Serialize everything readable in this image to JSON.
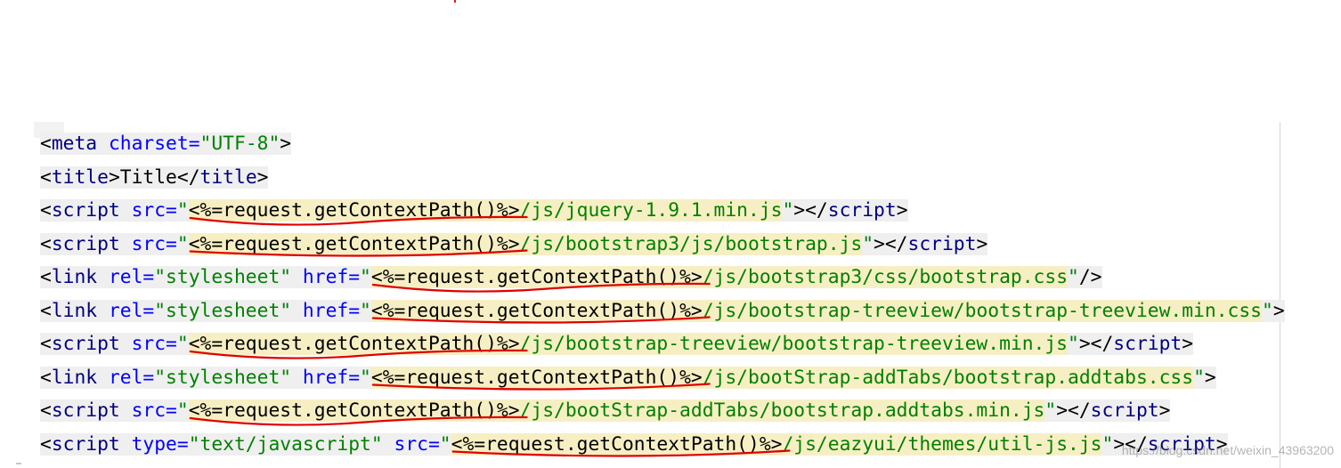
{
  "editor": {
    "lines": [
      {
        "id": "l1",
        "parts": [
          {
            "t": "<",
            "c": "bracket"
          },
          {
            "t": "meta",
            "c": "tag"
          },
          {
            "t": " charset=",
            "c": "attr"
          },
          {
            "t": "\"UTF-8\"",
            "c": "str"
          },
          {
            "t": ">",
            "c": "bracket"
          }
        ]
      },
      {
        "id": "l2",
        "parts": [
          {
            "t": "<",
            "c": "bracket"
          },
          {
            "t": "title",
            "c": "tag"
          },
          {
            "t": ">",
            "c": "bracket"
          },
          {
            "t": "Title",
            "c": "txt"
          },
          {
            "t": "</",
            "c": "bracket"
          },
          {
            "t": "title",
            "c": "tag"
          },
          {
            "t": ">",
            "c": "bracket"
          }
        ]
      },
      {
        "id": "l3",
        "parts": [
          {
            "t": "<",
            "c": "bracket"
          },
          {
            "t": "script",
            "c": "tag"
          },
          {
            "t": " src=",
            "c": "attr"
          },
          {
            "t": "\"",
            "c": "str"
          },
          {
            "t": "<%=request.getContextPath()%>",
            "c": "jsp"
          },
          {
            "t": "/js/jquery-1.9.1.min.js",
            "c": "strbg"
          },
          {
            "t": "\"",
            "c": "str"
          },
          {
            "t": "></",
            "c": "bracket"
          },
          {
            "t": "script",
            "c": "tag"
          },
          {
            "t": ">",
            "c": "bracket"
          }
        ]
      },
      {
        "id": "l4",
        "parts": [
          {
            "t": "<",
            "c": "bracket"
          },
          {
            "t": "script",
            "c": "tag"
          },
          {
            "t": " src=",
            "c": "attr"
          },
          {
            "t": "\"",
            "c": "str"
          },
          {
            "t": "<%=request.getContextPath()%>",
            "c": "jsp"
          },
          {
            "t": "/js/bootstrap3/js/bootstrap.js",
            "c": "strbg"
          },
          {
            "t": "\"",
            "c": "str"
          },
          {
            "t": "></",
            "c": "bracket"
          },
          {
            "t": "script",
            "c": "tag"
          },
          {
            "t": ">",
            "c": "bracket"
          }
        ]
      },
      {
        "id": "l5",
        "parts": [
          {
            "t": "<",
            "c": "bracket"
          },
          {
            "t": "link",
            "c": "tag"
          },
          {
            "t": " rel=",
            "c": "attr"
          },
          {
            "t": "\"stylesheet\"",
            "c": "str"
          },
          {
            "t": " href=",
            "c": "attr"
          },
          {
            "t": "\"",
            "c": "str"
          },
          {
            "t": "<%=request.getContextPath()%>",
            "c": "jsp"
          },
          {
            "t": "/js/bootstrap3/css/bootstrap.css",
            "c": "strbg"
          },
          {
            "t": "\"",
            "c": "str"
          },
          {
            "t": "/>",
            "c": "bracket"
          }
        ]
      },
      {
        "id": "l6",
        "parts": [
          {
            "t": "<",
            "c": "bracket"
          },
          {
            "t": "link",
            "c": "tag"
          },
          {
            "t": " rel=",
            "c": "attr"
          },
          {
            "t": "\"stylesheet\"",
            "c": "str"
          },
          {
            "t": " href=",
            "c": "attr"
          },
          {
            "t": "\"",
            "c": "str"
          },
          {
            "t": "<%=request.getContextPath()%>",
            "c": "jsp"
          },
          {
            "t": "/js/bootstrap-treeview/bootstrap-treeview.min.css",
            "c": "strbg"
          },
          {
            "t": "\"",
            "c": "str"
          },
          {
            "t": ">",
            "c": "bracket"
          }
        ]
      },
      {
        "id": "l7",
        "parts": [
          {
            "t": "<",
            "c": "bracket"
          },
          {
            "t": "script",
            "c": "tag"
          },
          {
            "t": " src=",
            "c": "attr"
          },
          {
            "t": "\"",
            "c": "str"
          },
          {
            "t": "<%=request.getContextPath()%>",
            "c": "jsp"
          },
          {
            "t": "/js/bootstrap-treeview/bootstrap-treeview.min.js",
            "c": "strbg"
          },
          {
            "t": "\"",
            "c": "str"
          },
          {
            "t": "></",
            "c": "bracket"
          },
          {
            "t": "script",
            "c": "tag"
          },
          {
            "t": ">",
            "c": "bracket"
          }
        ]
      },
      {
        "id": "l8",
        "parts": [
          {
            "t": "<",
            "c": "bracket"
          },
          {
            "t": "link",
            "c": "tag"
          },
          {
            "t": " rel=",
            "c": "attr"
          },
          {
            "t": "\"stylesheet\"",
            "c": "str"
          },
          {
            "t": " href=",
            "c": "attr"
          },
          {
            "t": "\"",
            "c": "str"
          },
          {
            "t": "<%=request.getContextPath()%>",
            "c": "jsp"
          },
          {
            "t": "/js/bootStrap-addTabs/bootstrap.addtabs.css",
            "c": "strbg"
          },
          {
            "t": "\"",
            "c": "str"
          },
          {
            "t": ">",
            "c": "bracket"
          }
        ]
      },
      {
        "id": "l9",
        "parts": [
          {
            "t": "<",
            "c": "bracket"
          },
          {
            "t": "script",
            "c": "tag"
          },
          {
            "t": " src=",
            "c": "attr"
          },
          {
            "t": "\"",
            "c": "str"
          },
          {
            "t": "<%=request.getContextPath()%>",
            "c": "jsp"
          },
          {
            "t": "/js/bootStrap-addTabs/bootstrap.addtabs.min.js",
            "c": "strbg"
          },
          {
            "t": "\"",
            "c": "str"
          },
          {
            "t": "></",
            "c": "bracket"
          },
          {
            "t": "script",
            "c": "tag"
          },
          {
            "t": ">",
            "c": "bracket"
          }
        ]
      },
      {
        "id": "l10",
        "parts": [
          {
            "t": "<",
            "c": "bracket"
          },
          {
            "t": "script",
            "c": "tag"
          },
          {
            "t": " type=",
            "c": "attr"
          },
          {
            "t": "\"text/javascript\"",
            "c": "str"
          },
          {
            "t": " src=",
            "c": "attr"
          },
          {
            "t": "\"",
            "c": "str"
          },
          {
            "t": "<%=request.getContextPath()%>",
            "c": "jsp"
          },
          {
            "t": "/js/eazyui/themes/util-js.js",
            "c": "strbg"
          },
          {
            "t": "\"",
            "c": "str"
          },
          {
            "t": "></",
            "c": "bracket"
          },
          {
            "t": "script",
            "c": "tag"
          },
          {
            "t": ">",
            "c": "bracket"
          }
        ]
      }
    ]
  },
  "watermark": "https://blog.csdn.net/weixin_43963200",
  "colors": {
    "tag": "#000080",
    "attr": "#0000ff",
    "string": "#008000",
    "jsp_highlight": "#f7efc4",
    "line_highlight": "#efefef",
    "annotation_underline": "#e00000"
  }
}
